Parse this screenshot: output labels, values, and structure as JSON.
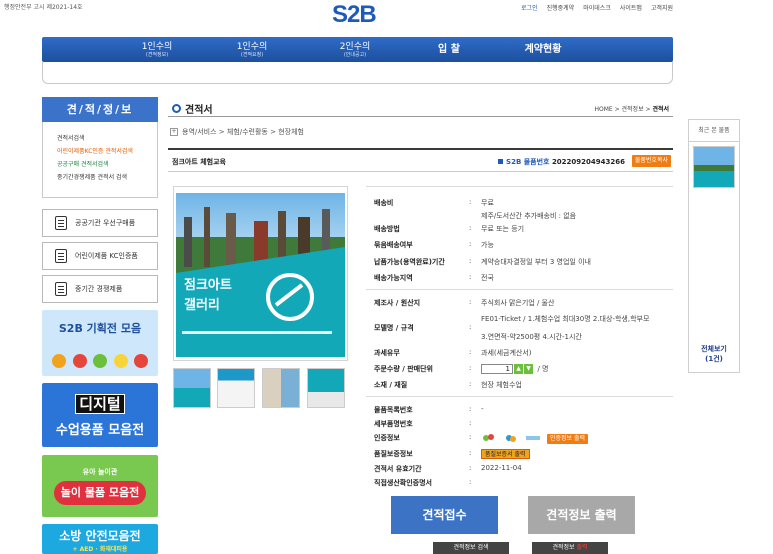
{
  "header": {
    "gov_notice": "행정안전부 고시 제2021-14호",
    "logo": "S2B",
    "util_links": [
      "로그인",
      "진행중계약",
      "마이데스크",
      "사이트맵",
      "고객지원"
    ]
  },
  "gnb": [
    {
      "main": "1인수의",
      "sub": "(견적정보)"
    },
    {
      "main": "1인수의",
      "sub": "(견적요청)"
    },
    {
      "main": "2인수의",
      "sub": "(안내공고)"
    },
    {
      "main": "입 찰",
      "sub": ""
    },
    {
      "main": "계약현황",
      "sub": ""
    }
  ],
  "sidebar": {
    "title": "견/적/정/보",
    "menu": [
      "견적서검색",
      "어린이제품KC인증 견적서검색",
      "공공구매 견적서검색",
      "중기간경쟁제품 견적서 검색"
    ],
    "buttons": [
      "공공기관 우선구매품",
      "어린이제품 KC인증품",
      "중기간 경쟁제품"
    ],
    "banners": {
      "s2b_title": "S2B 기획전 모음",
      "digital_1": "디지털",
      "digital_2": "수업용품 모음전",
      "play_1": "유아 놀이관",
      "play_2": "놀이 물품 모음전",
      "fire_1": "소방 안전모음전",
      "fire_2": "+ AED · 화재대피용"
    }
  },
  "content": {
    "page_title": "견적서",
    "breadcrumb": "HOME > 견적정보 > ",
    "breadcrumb_current": "견적서",
    "category_path": "용역/서비스 > 체험/수련활동 > 현장체험",
    "product_name": "점크아트 체험교육",
    "product_no_label": "S2B 물품번호",
    "product_no": "202209204943266",
    "copy_button": "물품번호복사",
    "image_text_1": "점크아트",
    "image_text_2": "갤러리"
  },
  "info": {
    "shipping_fee_label": "배송비",
    "shipping_fee": "무료",
    "shipping_fee_note": "제주/도서산간 추가배송비 : 없음",
    "shipping_method_label": "배송방법",
    "shipping_method": "무료 또는 등기",
    "bundle_label": "묶음배송여부",
    "bundle": "가능",
    "delivery_label": "납품가능(용역완료)기간",
    "delivery": "계약승대자결정일 부터 3 영업일 이내",
    "region_label": "배송가능지역",
    "region": "전국",
    "maker_label": "제조사 / 원산지",
    "maker": "주식회사 맑은기업 / 울산",
    "model_label": "모델명 / 규격",
    "model_1": "FE01-Ticket / 1.체험수업 최대30명 2.대상-학생,학부모",
    "model_2": "3.연면적-약2500평 4.시간-1시간",
    "tax_label": "과세유무",
    "tax": "과세(세금계산서)",
    "qty_label": "주문수량 / 판매단위",
    "qty_value": "1",
    "qty_unit": "명",
    "material_label": "소재 / 재질",
    "material": "현장 체험수업",
    "classification_label": "물품목록번호",
    "classification": "-",
    "detail_no_label": "세부품명번호",
    "detail_no": "",
    "cert_label": "인증정보",
    "cert_button": "인증정보 출력",
    "quality_label": "품질보증정보",
    "quality_badge": "품질보증서 출력",
    "valid_label": "견적서 유효기간",
    "valid": "2022-11-04",
    "direct_label": "직접생산확인증명서",
    "direct": ""
  },
  "actions": {
    "apply": "견적접수",
    "print": "견적정보 출력",
    "search_small": "견적정보 검색",
    "print_small_prefix": "견적정보 ",
    "print_small_red": "출력"
  },
  "recent": {
    "title": "최근 본 물품",
    "view_all": "전체보기",
    "count": "(1건)"
  },
  "colors": {
    "brand_blue": "#1e5bb8",
    "orange": "#f07c14",
    "apply_button": "#3c73c4"
  }
}
